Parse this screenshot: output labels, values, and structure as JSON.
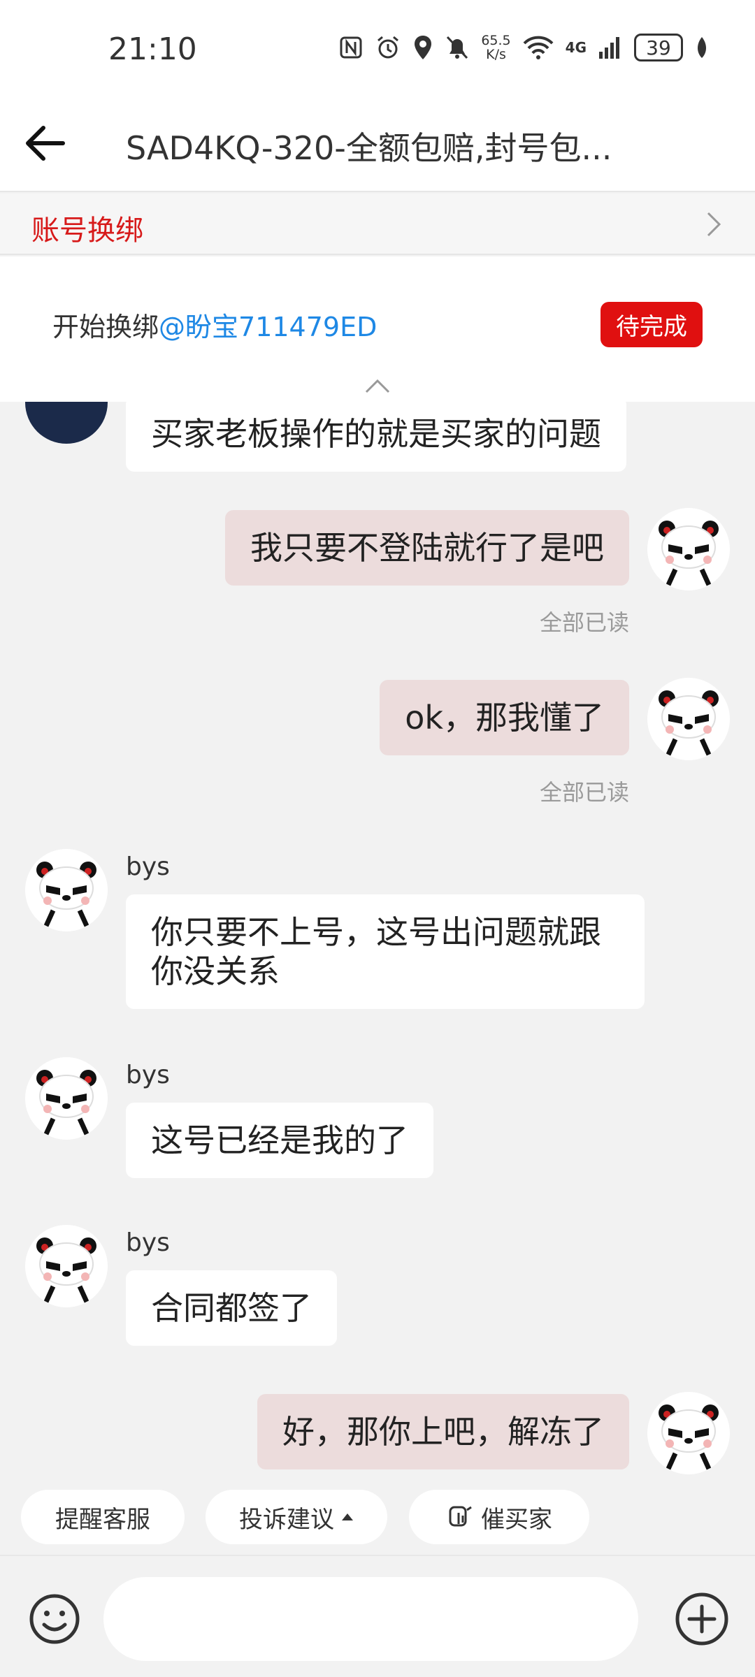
{
  "status_bar": {
    "time": "21:10",
    "net_speed_value": "65.5",
    "net_speed_unit": "K/s",
    "network": "4G",
    "battery": "39"
  },
  "header": {
    "title": "SAD4KQ-320-全额包赔,封号包..."
  },
  "bind_bar": {
    "label": "账号换绑"
  },
  "bind_panel": {
    "text": "开始换绑",
    "mention": "@盼宝711479ED",
    "status": "待完成"
  },
  "messages": [
    {
      "side": "in",
      "text": "买家老板操作的就是买家的问题"
    },
    {
      "side": "out",
      "text": "我只要不登陆就行了是吧",
      "read": "全部已读"
    },
    {
      "side": "out",
      "text": "ok，那我懂了",
      "read": "全部已读"
    },
    {
      "side": "in",
      "nick": "bys",
      "text": "你只要不上号，这号出问题就跟你没关系"
    },
    {
      "side": "in",
      "nick": "bys",
      "text": "这号已经是我的了"
    },
    {
      "side": "in",
      "nick": "bys",
      "text": "合同都签了"
    },
    {
      "side": "out",
      "text": "好，那你上吧，解冻了"
    }
  ],
  "quick_actions": [
    {
      "label": "提醒客服"
    },
    {
      "label": "投诉建议"
    },
    {
      "label": "催买家"
    }
  ],
  "input": {
    "placeholder": ""
  },
  "colors": {
    "accent_red": "#d71a1a",
    "badge_red": "#e01010",
    "mention_blue": "#1e88e5",
    "outgoing_bubble": "#ecdcdc"
  }
}
